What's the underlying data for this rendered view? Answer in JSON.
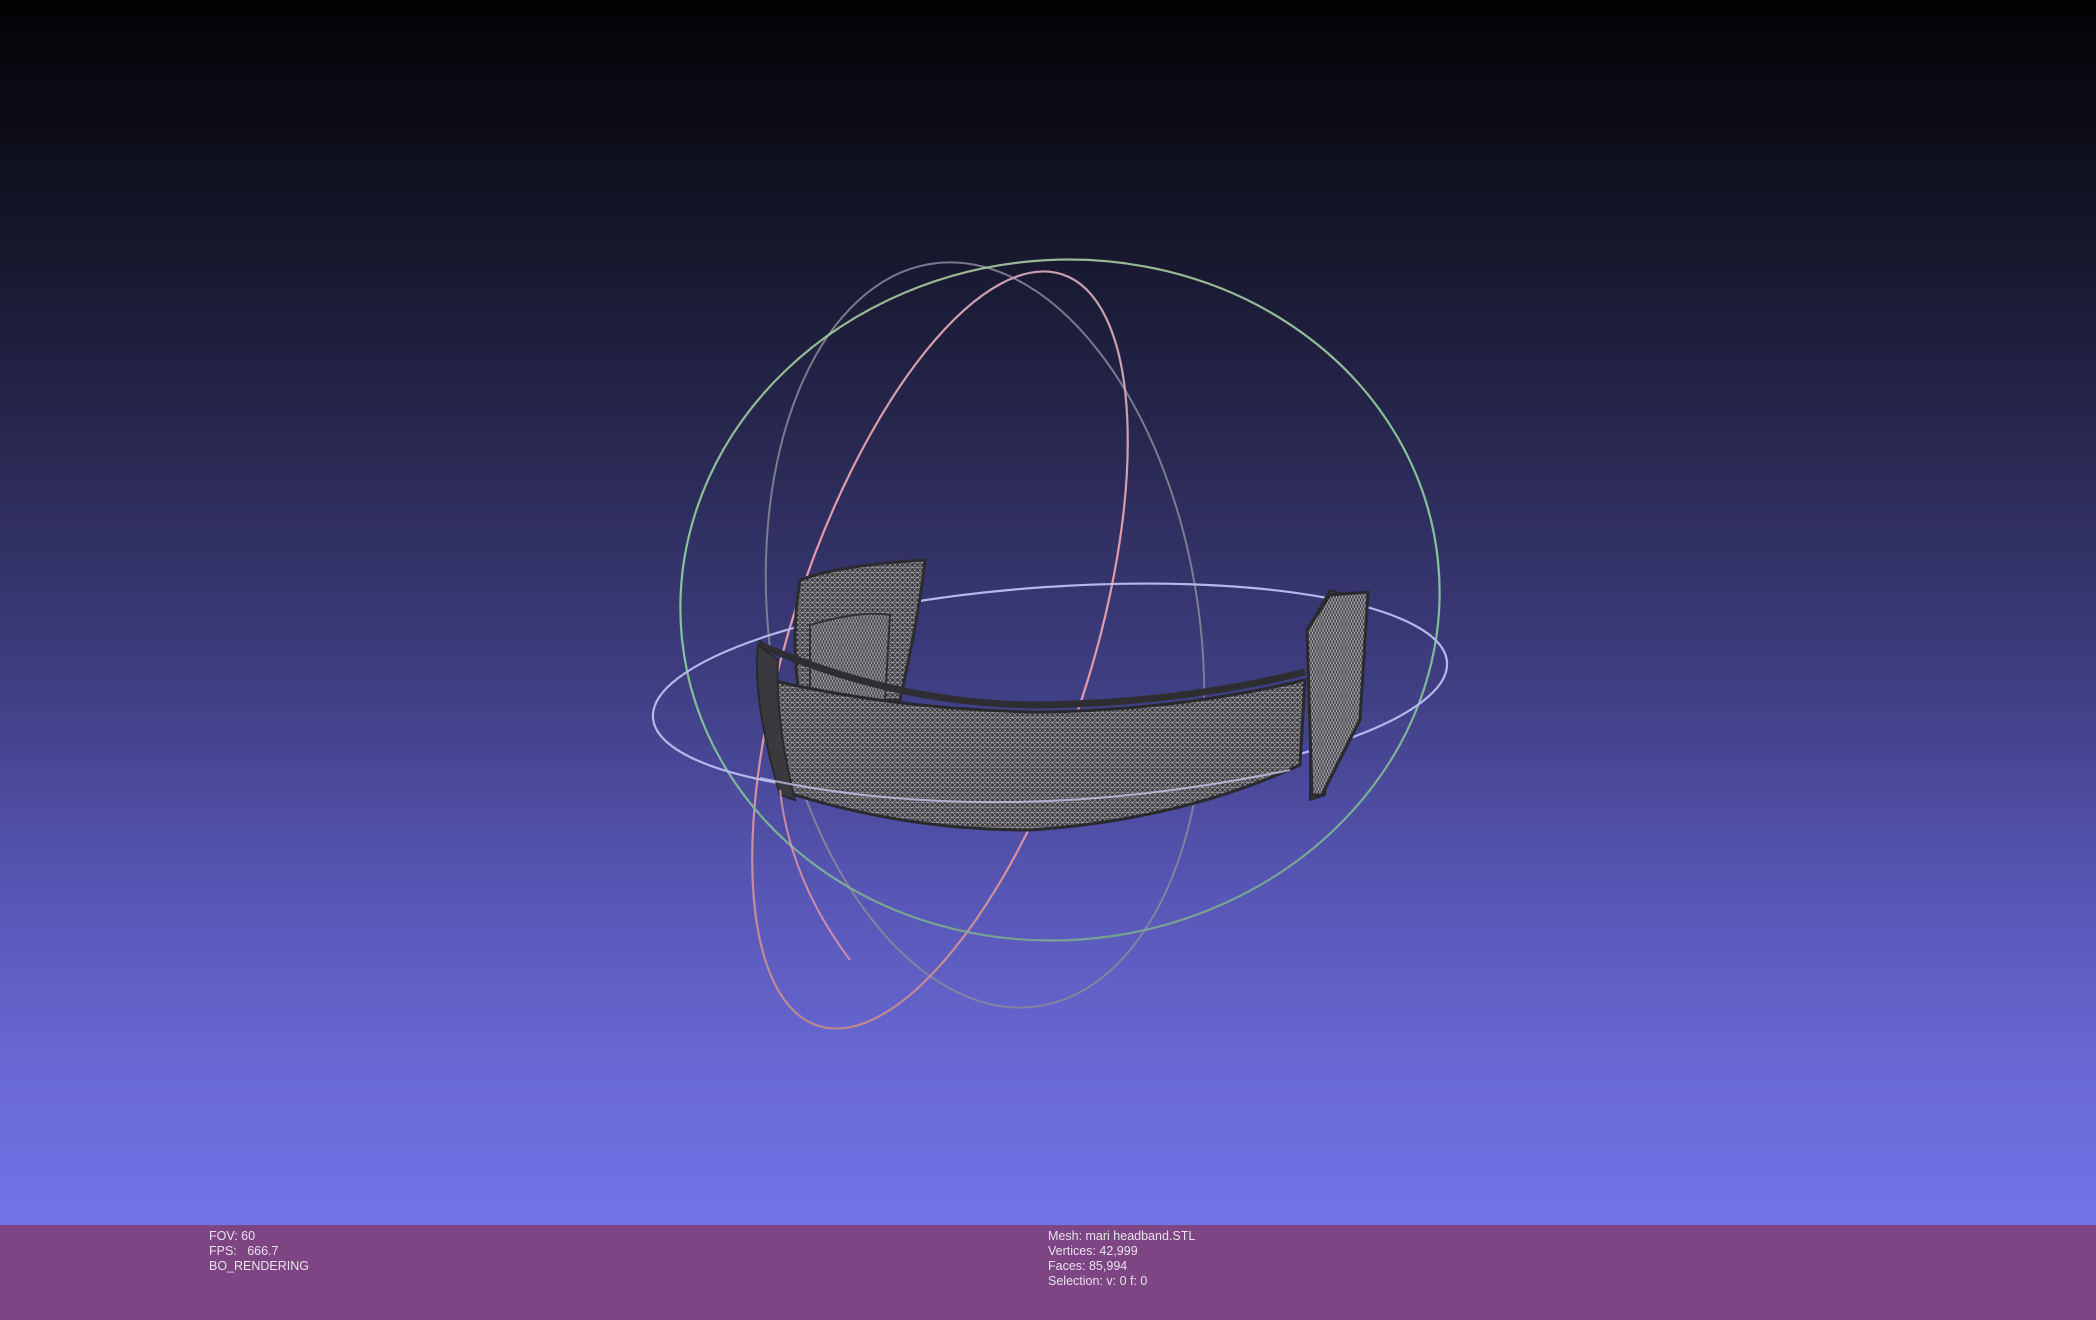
{
  "viewer": {
    "background_top": "#020204",
    "background_bottom": "#7473e8",
    "trackball": {
      "x_ring_color": "#e89aa8",
      "y_ring_color": "#9ad8a8",
      "z_ring_color": "#b0b4e8",
      "neutral_ring_color": "#9a9aa8"
    },
    "mesh_wire_color": "#9a9aa0"
  },
  "status_bar": {
    "background": "#7e4585",
    "left": {
      "fov": "FOV: 60",
      "fps": "FPS:   666.7",
      "render_mode": "BO_RENDERING"
    },
    "right": {
      "mesh": "Mesh: mari headband.STL",
      "vertices": "Vertices: 42,999",
      "faces": "Faces: 85,994",
      "selection": "Selection: v: 0 f: 0"
    }
  }
}
